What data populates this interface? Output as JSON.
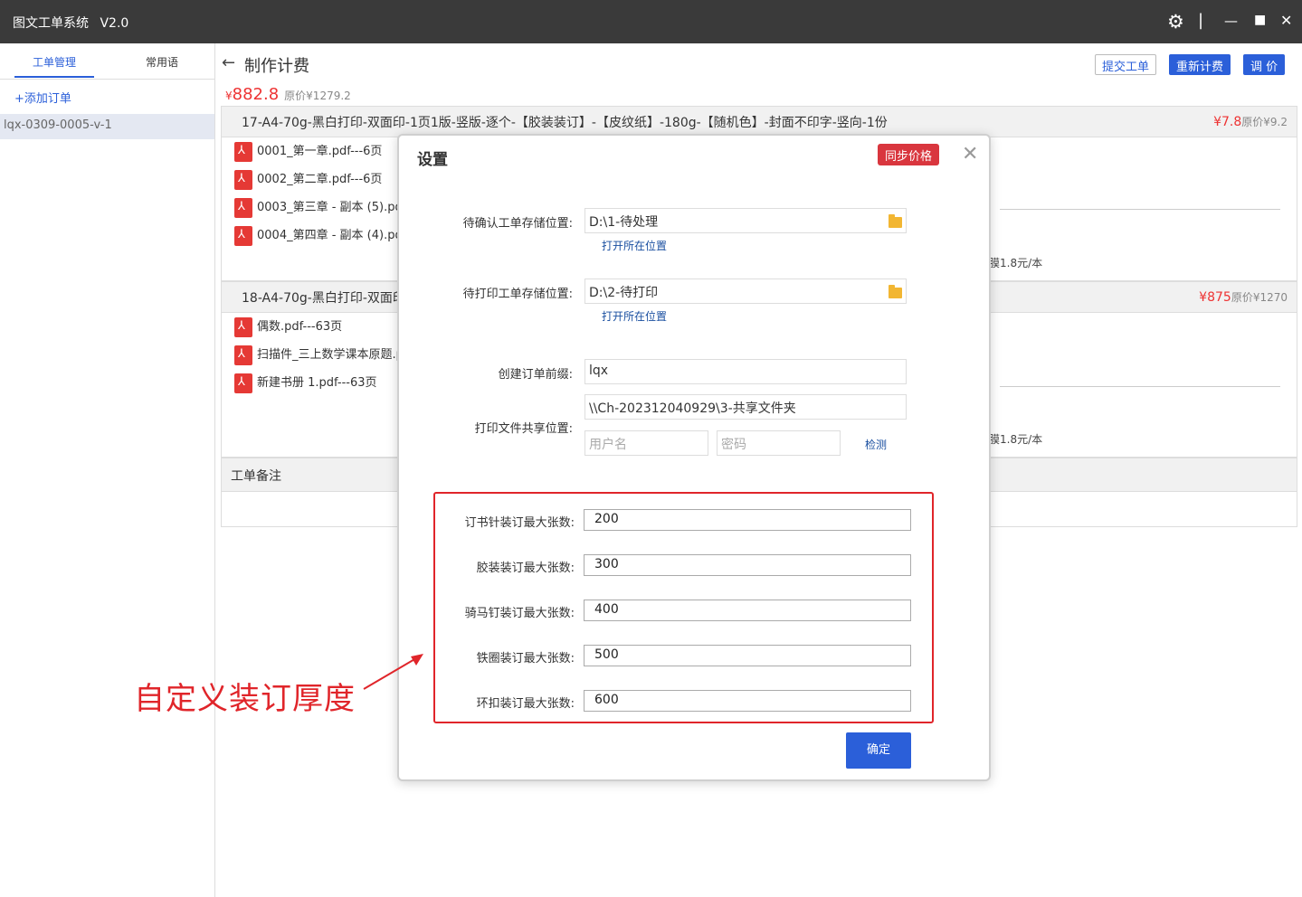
{
  "window": {
    "title": "图文工单系统",
    "version": "V2.0",
    "controls": [
      "⚙",
      "|",
      "—",
      "■",
      "✕"
    ]
  },
  "sidebar": {
    "tabs": [
      {
        "label": "工单管理",
        "active": true
      },
      {
        "label": "常用语",
        "active": false
      }
    ],
    "add_order": "+添加订单",
    "orders": [
      "lqx-0309-0005-v-1"
    ]
  },
  "main": {
    "title": "制作计费",
    "buttons": {
      "submit": "提交工单",
      "recalc": "重新计费",
      "adjust": "调 价"
    },
    "total": {
      "currency": "¥",
      "price": "882.8",
      "original": "原价¥1279.2"
    },
    "items": [
      {
        "title": "17-A4-70g-黑白打印-双面印-1页1版-竖版-逐个-【胶装装订】-【皮纹纸】-180g-【随机色】-封面不印字-竖向-1份",
        "price": "¥7.8",
        "original": "原价¥9.2",
        "files": [
          "0001_第一章.pdf---6页",
          "0002_第二章.pdf---6页",
          "0003_第三章 - 副本 (5).pdf---",
          "0004_第四章 - 副本 (4).pdf---"
        ],
        "note": "膜1.8元/本"
      },
      {
        "title": "18-A4-70g-黑白打印-双面印",
        "price": "¥875",
        "original": "原价¥1270",
        "files": [
          "偶数.pdf---63页",
          "扫描件_三上数学课本原题.pdf",
          "新建书册 1.pdf---63页"
        ],
        "note": "膜1.8元/本"
      }
    ],
    "note_header": "工单备注"
  },
  "dialog": {
    "title": "设置",
    "sync_button": "同步价格",
    "close": "✕",
    "pending_confirm": {
      "label": "待确认工单存储位置:",
      "value": "D:\\1-待处理",
      "open_link": "打开所在位置"
    },
    "pending_print": {
      "label": "待打印工单存储位置:",
      "value": "D:\\2-待打印",
      "open_link": "打开所在位置"
    },
    "prefix": {
      "label": "创建订单前缀:",
      "value": "lqx"
    },
    "share": {
      "label": "打印文件共享位置:",
      "value": "\\\\Ch-202312040929\\3-共享文件夹",
      "username_placeholder": "用户名",
      "password_placeholder": "密码",
      "detect": "检测"
    },
    "binding_limits": [
      {
        "label": "订书针装订最大张数:",
        "value": "200"
      },
      {
        "label": "胶装装订最大张数:",
        "value": "300"
      },
      {
        "label": "骑马钉装订最大张数:",
        "value": "400"
      },
      {
        "label": "铁圈装订最大张数:",
        "value": "500"
      },
      {
        "label": "环扣装订最大张数:",
        "value": "600"
      }
    ],
    "confirm_button": "确定"
  },
  "annotation": {
    "text": "自定义装订厚度",
    "color": "#e0252a"
  },
  "colors": {
    "accent": "#2b5fd9",
    "price_red": "#e33333",
    "sync_red": "#d9363e",
    "titlebar": "#3a3a3a"
  }
}
